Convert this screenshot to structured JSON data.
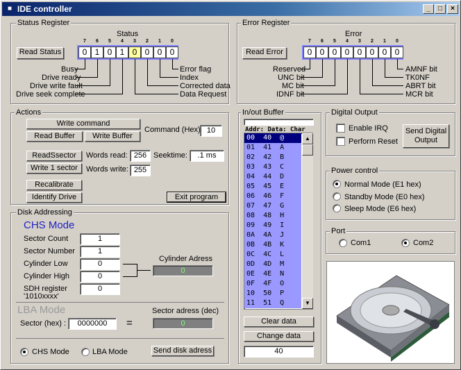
{
  "window": {
    "title": "IDE controller",
    "min": "_",
    "max": "□",
    "close": "×"
  },
  "status": {
    "group": "Status Register",
    "title": "Status",
    "button": "Read Status",
    "bitnums": [
      "7",
      "6",
      "5",
      "4",
      "3",
      "2",
      "1",
      "0"
    ],
    "bits": [
      "0",
      "1",
      "0",
      "1",
      "0",
      "0",
      "0",
      "0"
    ],
    "left_labels": [
      "Busy",
      "Drive ready",
      "Drive write fault",
      "Drive seek complete"
    ],
    "right_labels": [
      "Error flag",
      "Index",
      "Corrected data",
      "Data Request"
    ]
  },
  "error": {
    "group": "Error Register",
    "title": "Error",
    "button": "Read Error",
    "bitnums": [
      "7",
      "6",
      "5",
      "4",
      "3",
      "2",
      "1",
      "0"
    ],
    "bits": [
      "0",
      "0",
      "0",
      "0",
      "0",
      "0",
      "0",
      "0"
    ],
    "left_labels": [
      "Reserved",
      "UNC bit",
      "MC bit",
      "IDNF bit"
    ],
    "right_labels": [
      "AMNF bit",
      "TK0NF",
      "ABRT bit",
      "MCR bit"
    ]
  },
  "actions": {
    "group": "Actions",
    "write_command": "Write command",
    "read_buffer": "Read Buffer",
    "write_buffer": "Write Buffer",
    "command_label": "Command (Hex):",
    "command_value": "10",
    "read_sector": "ReadSsector",
    "write_sector": "Write 1 sector",
    "words_read_label": "Words read:",
    "words_read": "256",
    "words_write_label": "Words write:",
    "words_write": "255",
    "seektime_label": "Seektime:",
    "seektime": ".1 ms",
    "recalibrate": "Recalibrate",
    "identify": "Identify Drive",
    "exit": "Exit program"
  },
  "disk": {
    "group": "Disk Addressing",
    "chs_title": "CHS Mode",
    "sector_count_label": "Sector Count",
    "sector_count": "1",
    "sector_number_label": "Sector Number",
    "sector_number": "1",
    "cyl_low_label": "Cylinder Low",
    "cyl_low": "0",
    "cyl_high_label": "Cylinder High",
    "cyl_high": "0",
    "sdh_label": "SDH register",
    "sdh_label2": "'1010xxxx'",
    "sdh": "0",
    "cyl_addr_label": "Cylinder Adress",
    "cyl_addr": "0",
    "lba_title": "LBA Mode",
    "sector_hex_label": "Sector (hex) :",
    "sector_hex": "0000000",
    "equals": "=",
    "sector_dec_label": "Sector adress (dec)",
    "sector_dec": "0",
    "radio_chs": "CHS Mode",
    "radio_lba": "LBA Mode",
    "send": "Send disk adress"
  },
  "buffer": {
    "group": "In/out Buffer",
    "header": "Addr: Data: Char",
    "rows": [
      "00  40  @",
      "01  41  A",
      "02  42  B",
      "03  43  C",
      "04  44  D",
      "05  45  E",
      "06  46  F",
      "07  47  G",
      "08  48  H",
      "09  49  I",
      "0A  4A  J",
      "0B  4B  K",
      "0C  4C  L",
      "0D  4D  M",
      "0E  4E  N",
      "0F  4F  O",
      "10  50  P",
      "11  51  Q"
    ],
    "clear": "Clear data",
    "change": "Change data",
    "value": "40"
  },
  "digital": {
    "group": "Digital Output",
    "irq": "Enable IRQ",
    "reset": "Perform Reset",
    "send": "Send Digital Output"
  },
  "power": {
    "group": "Power control",
    "normal": "Normal Mode (E1 hex)",
    "standby": "Standby Mode (E0 hex)",
    "sleep": "Sleep Mode (E6 hex)"
  },
  "port": {
    "group": "Port",
    "com1": "Com1",
    "com2": "Com2"
  }
}
